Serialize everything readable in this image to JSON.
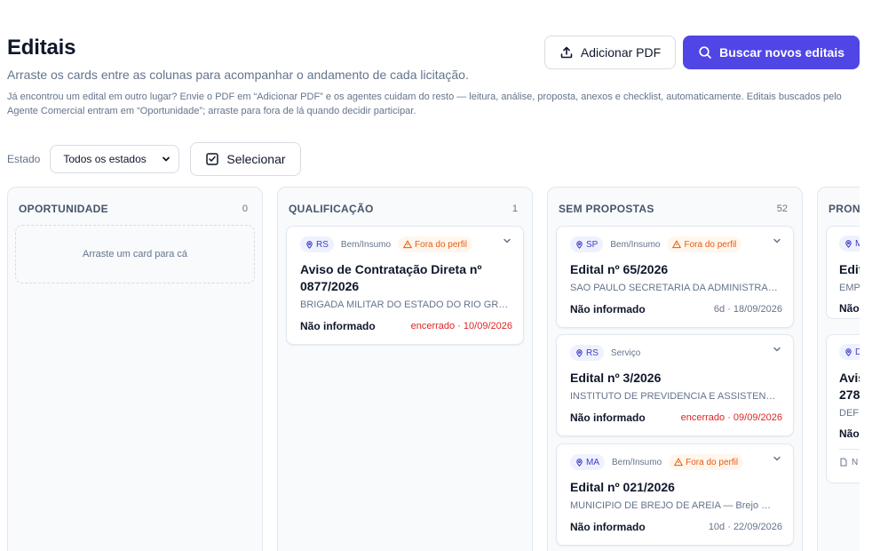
{
  "header": {
    "title": "Editais",
    "subtitle": "Arraste os cards entre as colunas para acompanhar o andamento de cada licitação.",
    "help": "Já encontrou um edital em outro lugar? Envie o PDF em “Adicionar PDF” e os agentes cuidam do resto — leitura, análise, proposta, anexos e checklist, automaticamente. Editais buscados pelo Agente Comercial entram em “Oportunidade”; arraste para fora de lá quando decidir participar."
  },
  "actions": {
    "add_pdf": "Adicionar PDF",
    "search_new": "Buscar novos editais"
  },
  "filters": {
    "state_label": "Estado",
    "state_value": "Todos os estados",
    "select_label": "Selecionar"
  },
  "colors": {
    "accent": "#4f46e5",
    "warning": "#ea580c",
    "late": "#dc2626"
  },
  "columns": [
    {
      "title": "OPORTUNIDADE",
      "count": "0",
      "empty_text": "Arraste um card para cá",
      "cards": []
    },
    {
      "title": "QUALIFICAÇÃO",
      "count": "1",
      "cards": [
        {
          "uf": "RS",
          "type": "Bem/Insumo",
          "flag": "Fora do perfil",
          "title": "Aviso de Contratação Direta nº 0877/2026",
          "org": "BRIGADA MILITAR DO ESTADO DO RIO GR…",
          "value": "Não informado",
          "deadline": "encerrado · 10/09/2026"
        }
      ]
    },
    {
      "title": "SEM PROPOSTAS",
      "count": "52",
      "cards": [
        {
          "uf": "SP",
          "type": "Bem/Insumo",
          "flag": "Fora do perfil",
          "title": "Edital nº 65/2026",
          "org": "SAO PAULO SECRETARIA DA ADMINISTRA…",
          "value": "Não informado",
          "deadline": "6d · 18/09/2026"
        },
        {
          "uf": "RS",
          "type": "Serviço",
          "title": "Edital nº 3/2026",
          "org": "INSTITUTO DE PREVIDENCIA E ASSISTEN…",
          "value": "Não informado",
          "deadline": "encerrado · 09/09/2026"
        },
        {
          "uf": "MA",
          "type": "Bem/Insumo",
          "flag": "Fora do perfil",
          "title": "Edital nº 021/2026",
          "org": "MUNICIPIO DE BREJO DE AREIA — Brejo …",
          "value": "Não informado",
          "deadline": "10d · 22/09/2026"
        }
      ]
    },
    {
      "title": "PRON",
      "cards": [
        {
          "uf": "M",
          "title": "Edit",
          "org": "EMP",
          "value": "Não"
        },
        {
          "uf": "D",
          "title": "Avis",
          "title2": "278",
          "org": "DEF",
          "value": "Não",
          "file": "N"
        }
      ]
    }
  ]
}
